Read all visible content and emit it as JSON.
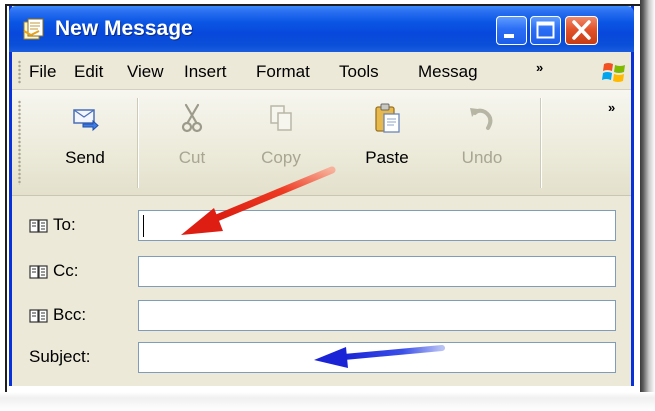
{
  "window": {
    "title": "New Message"
  },
  "menu": {
    "items": [
      "File",
      "Edit",
      "View",
      "Insert",
      "Format",
      "Tools",
      "Messag"
    ],
    "overflow": "»"
  },
  "toolbar": {
    "send": "Send",
    "cut": "Cut",
    "copy": "Copy",
    "paste": "Paste",
    "undo": "Undo",
    "overflow": "»"
  },
  "fields": {
    "to_label": "To:",
    "cc_label": "Cc:",
    "bcc_label": "Bcc:",
    "subject_label": "Subject:",
    "to_value": "",
    "cc_value": "",
    "bcc_value": "",
    "subject_value": ""
  },
  "colors": {
    "title_bar": "#0a56e4",
    "close_button": "#e2532b",
    "red_arrow": "#e8231b",
    "blue_arrow": "#1b2ad8"
  },
  "icons": {
    "title": "new-message-icon",
    "send": "send-icon",
    "cut": "scissors-icon",
    "copy": "copy-icon",
    "paste": "clipboard-icon",
    "undo": "undo-icon",
    "address_book": "address-book-icon"
  }
}
